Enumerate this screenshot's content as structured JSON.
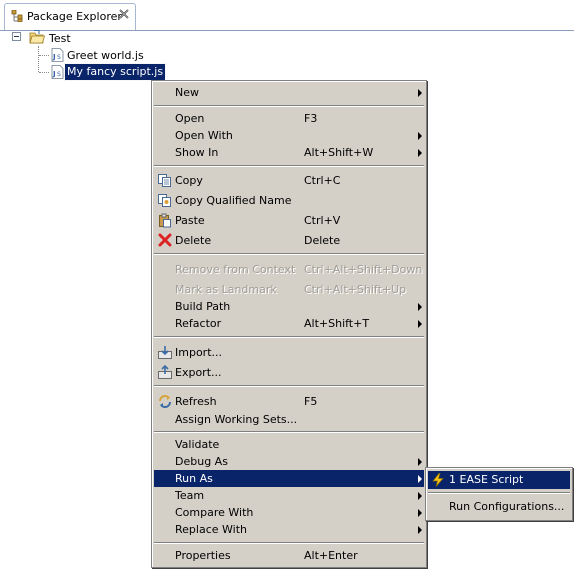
{
  "view": {
    "title": "Package Explorer",
    "icon": "package-explorer-icon",
    "close_icon": "close-icon"
  },
  "tree": {
    "project": "Test",
    "files": [
      "Greet world.js",
      "My fancy script.js"
    ],
    "selected_file": "My fancy script.js"
  },
  "menu": {
    "items": [
      {
        "label": "New",
        "shortcut": "",
        "submenu": true
      },
      {
        "label": "Open",
        "shortcut": "F3"
      },
      {
        "label": "Open With",
        "shortcut": "",
        "submenu": true
      },
      {
        "label": "Show In",
        "shortcut": "Alt+Shift+W",
        "submenu": true
      },
      {
        "label": "Copy",
        "shortcut": "Ctrl+C",
        "icon": "copy-icon"
      },
      {
        "label": "Copy Qualified Name",
        "shortcut": "",
        "icon": "copy-qualified-name-icon"
      },
      {
        "label": "Paste",
        "shortcut": "Ctrl+V",
        "icon": "paste-icon"
      },
      {
        "label": "Delete",
        "shortcut": "Delete",
        "icon": "delete-icon"
      },
      {
        "label": "Remove from Context",
        "shortcut": "Ctrl+Alt+Shift+Down",
        "disabled": true
      },
      {
        "label": "Mark as Landmark",
        "shortcut": "Ctrl+Alt+Shift+Up",
        "disabled": true
      },
      {
        "label": "Build Path",
        "shortcut": "",
        "submenu": true
      },
      {
        "label": "Refactor",
        "shortcut": "Alt+Shift+T",
        "submenu": true
      },
      {
        "label": "Import...",
        "shortcut": "",
        "icon": "import-icon"
      },
      {
        "label": "Export...",
        "shortcut": "",
        "icon": "export-icon"
      },
      {
        "label": "Refresh",
        "shortcut": "F5",
        "icon": "refresh-icon"
      },
      {
        "label": "Assign Working Sets...",
        "shortcut": ""
      },
      {
        "label": "Validate",
        "shortcut": ""
      },
      {
        "label": "Debug As",
        "shortcut": "",
        "submenu": true
      },
      {
        "label": "Run As",
        "shortcut": "",
        "submenu": true,
        "active": true
      },
      {
        "label": "Team",
        "shortcut": "",
        "submenu": true
      },
      {
        "label": "Compare With",
        "shortcut": "",
        "submenu": true
      },
      {
        "label": "Replace With",
        "shortcut": "",
        "submenu": true
      },
      {
        "label": "Properties",
        "shortcut": "Alt+Enter"
      }
    ]
  },
  "submenu": {
    "items": [
      {
        "label": "1 EASE Script",
        "icon": "ease-script-icon",
        "active": true
      },
      {
        "label": "Run Configurations..."
      }
    ]
  },
  "colors": {
    "selection": "#0a246a",
    "menu_background": "#d4d0c8",
    "disabled_text": "#a19e97"
  }
}
